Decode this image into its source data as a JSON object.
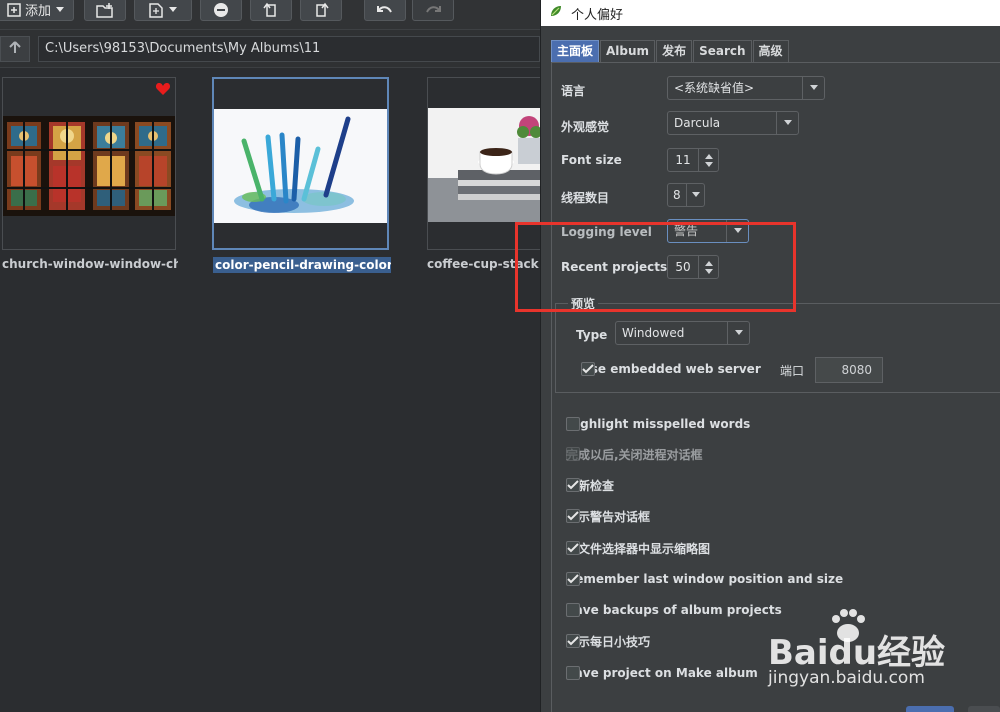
{
  "toolbar": {
    "add_label": "添加"
  },
  "address_bar": {
    "path": "C:\\Users\\98153\\Documents\\My Albums\\11"
  },
  "thumbnails": [
    {
      "caption": "church-window-window-church",
      "favorite": true,
      "selected": false
    },
    {
      "caption": "color-pencil-drawing-coloring",
      "favorite": false,
      "selected": true
    },
    {
      "caption": "coffee-cup-stack-b",
      "favorite": false,
      "selected": false
    }
  ],
  "dialog": {
    "title": "个人偏好",
    "tabs": [
      "主面板",
      "Album",
      "发布",
      "Search",
      "高级"
    ],
    "active_tab": "主面板",
    "settings": {
      "language": {
        "label": "语言",
        "value": "<系统缺省值>"
      },
      "look_feel": {
        "label": "外观感觉",
        "value": "Darcula"
      },
      "font_size": {
        "label": "Font size",
        "value": "11"
      },
      "threads": {
        "label": "线程数目",
        "value": "8"
      },
      "logging": {
        "label": "Logging level",
        "value": "警告"
      },
      "recent_projects": {
        "label": "Recent projects",
        "value": "50"
      }
    },
    "preview": {
      "group_title": "预览",
      "type_label": "Type",
      "type_value": "Windowed",
      "embedded_label": "Use embedded web server",
      "embedded_checked": true,
      "port_label": "端口",
      "port_value": "8080"
    },
    "options": [
      {
        "label": "Highlight misspelled words",
        "checked": false,
        "enabled": true
      },
      {
        "label": "完成以后,关闭进程对话框",
        "checked": false,
        "enabled": false
      },
      {
        "label": "更新检查",
        "checked": true,
        "enabled": true
      },
      {
        "label": "显示警告对话框",
        "checked": true,
        "enabled": true
      },
      {
        "label": "在文件选择器中显示缩略图",
        "checked": true,
        "enabled": true
      },
      {
        "label": "Remember last window position and size",
        "checked": true,
        "enabled": true
      },
      {
        "label": "Save backups of album projects",
        "checked": false,
        "enabled": true
      },
      {
        "label": "显示每日小技巧",
        "checked": true,
        "enabled": true
      },
      {
        "label": "Save project on Make album",
        "checked": false,
        "enabled": true
      }
    ]
  },
  "watermark": {
    "main": "Baidu经验",
    "sub": "jingyan.baidu.com"
  },
  "colors": {
    "accent": "#4b6eaf",
    "highlight_box": "#e8342c",
    "background": "#2b2d30",
    "dialog": "#3c3f41"
  }
}
